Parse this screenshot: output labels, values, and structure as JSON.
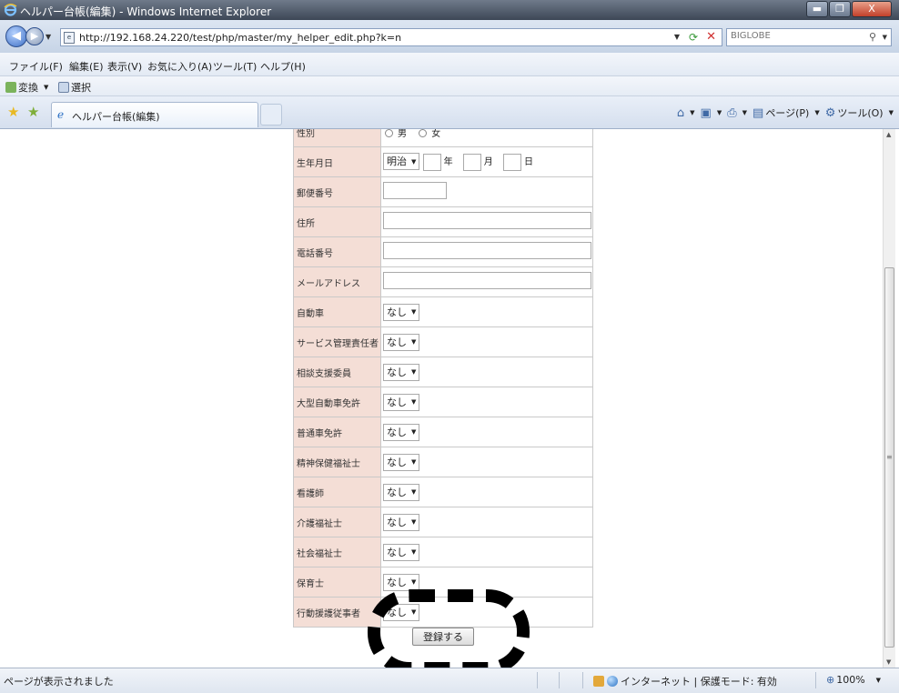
{
  "window": {
    "title": "ヘルパー台帳(編集) - Windows Internet Explorer",
    "minimize": "▬",
    "maximize": "❐",
    "close": "X"
  },
  "address": {
    "url": "http://192.168.24.220/test/php/master/my_helper_edit.php?k=n",
    "search_placeholder": "BIGLOBE"
  },
  "menu": {
    "items": [
      "ファイル(F)",
      "編集(E)",
      "表示(V)",
      "お気に入り(A)",
      "ツール(T)",
      "ヘルプ(H)"
    ]
  },
  "toolbar2": {
    "convert": "変換",
    "select": "選択"
  },
  "tab": {
    "label": "ヘルパー台帳(編集)"
  },
  "command_bar": {
    "page": "ページ(P)",
    "tools": "ツール(O)"
  },
  "form": {
    "rows": [
      {
        "label": "性別",
        "type": "radio",
        "options": [
          "男",
          "女"
        ]
      },
      {
        "label": "生年月日",
        "type": "date",
        "era": "明治",
        "year_unit": "年",
        "month_unit": "月",
        "day_unit": "日"
      },
      {
        "label": "郵便番号",
        "type": "text-short",
        "value": ""
      },
      {
        "label": "住所",
        "type": "text",
        "value": ""
      },
      {
        "label": "電話番号",
        "type": "text",
        "value": ""
      },
      {
        "label": "メールアドレス",
        "type": "text",
        "value": ""
      },
      {
        "label": "自動車",
        "type": "select",
        "value": "なし"
      },
      {
        "label": "サービス管理責任者",
        "type": "select",
        "value": "なし"
      },
      {
        "label": "相談支援委員",
        "type": "select",
        "value": "なし"
      },
      {
        "label": "大型自動車免許",
        "type": "select",
        "value": "なし"
      },
      {
        "label": "普通車免許",
        "type": "select",
        "value": "なし"
      },
      {
        "label": "精神保健福祉士",
        "type": "select",
        "value": "なし"
      },
      {
        "label": "看護師",
        "type": "select",
        "value": "なし"
      },
      {
        "label": "介護福祉士",
        "type": "select",
        "value": "なし"
      },
      {
        "label": "社会福祉士",
        "type": "select",
        "value": "なし"
      },
      {
        "label": "保育士",
        "type": "select",
        "value": "なし"
      },
      {
        "label": "行動援護従事者",
        "type": "select",
        "value": "なし"
      }
    ],
    "submit": "登録する"
  },
  "status": {
    "text": "ページが表示されました",
    "zone": "インターネット | 保護モード: 有効",
    "zoom": "100%"
  }
}
